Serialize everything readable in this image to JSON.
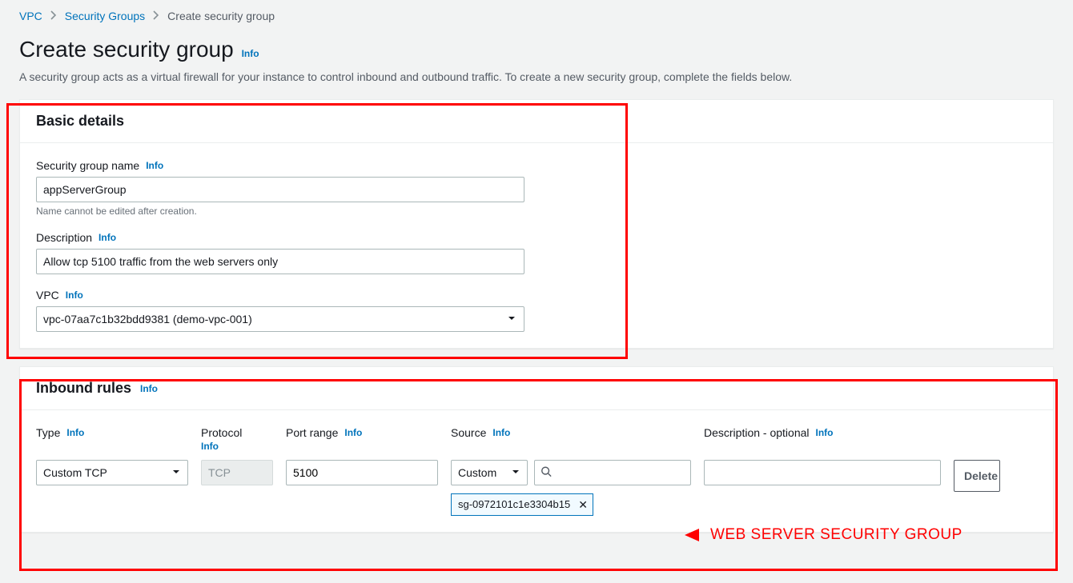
{
  "breadcrumb": {
    "vpc": "VPC",
    "sg": "Security Groups",
    "current": "Create security group"
  },
  "title": "Create security group",
  "info_label": "Info",
  "subtitle": "A security group acts as a virtual firewall for your instance to control inbound and outbound traffic. To create a new security group, complete the fields below.",
  "basic": {
    "heading": "Basic details",
    "name_label": "Security group name",
    "name_value": "appServerGroup",
    "name_help": "Name cannot be edited after creation.",
    "desc_label": "Description",
    "desc_value": "Allow tcp 5100 traffic from the web servers only",
    "vpc_label": "VPC",
    "vpc_value": "vpc-07aa7c1b32bdd9381 (demo-vpc-001)"
  },
  "inbound": {
    "heading": "Inbound rules",
    "cols": {
      "type": "Type",
      "protocol": "Protocol",
      "port": "Port range",
      "source": "Source",
      "desc": "Description - optional"
    },
    "row": {
      "type": "Custom TCP",
      "protocol": "TCP",
      "port": "5100",
      "source_mode": "Custom",
      "source_search": "",
      "source_token": "sg-0972101c1e3304b15",
      "desc": "",
      "delete": "Delete"
    }
  },
  "annotation_text": "WEB SERVER SECURITY GROUP"
}
